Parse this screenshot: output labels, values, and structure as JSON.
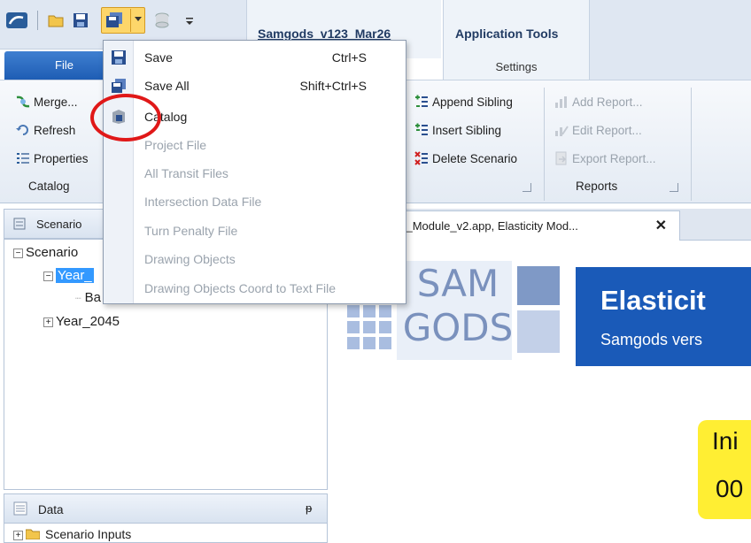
{
  "title_bar": {
    "document_tab": "Samgods_v123_Mar26",
    "app_tools": "Application Tools",
    "settings": "Settings"
  },
  "file_tab": "File",
  "ribbon": {
    "catalog_group": {
      "label": "Catalog",
      "merge": "Merge...",
      "refresh": "Refresh",
      "properties": "Properties"
    },
    "scenario_group": {
      "append_sibling": "Append Sibling",
      "insert_sibling": "Insert Sibling",
      "delete_scenario": "Delete Scenario"
    },
    "reports_group": {
      "label": "Reports",
      "add_report": "Add Report...",
      "edit_report": "Edit Report...",
      "export_report": "Export Report..."
    }
  },
  "save_menu": {
    "items": [
      {
        "label": "Save",
        "shortcut": "Ctrl+S",
        "enabled": true
      },
      {
        "label": "Save All",
        "shortcut": "Shift+Ctrl+S",
        "enabled": true
      },
      {
        "label": "Catalog",
        "shortcut": "",
        "enabled": true
      },
      {
        "label": "Project File",
        "shortcut": "",
        "enabled": false
      },
      {
        "label": "All Transit Files",
        "shortcut": "",
        "enabled": false
      },
      {
        "label": "Intersection Data File",
        "shortcut": "",
        "enabled": false
      },
      {
        "label": "Turn Penalty File",
        "shortcut": "",
        "enabled": false
      },
      {
        "label": "Drawing Objects",
        "shortcut": "",
        "enabled": false
      },
      {
        "label": "Drawing Objects Coord to Text File",
        "shortcut": "",
        "enabled": false
      }
    ]
  },
  "scenario_panel": {
    "title": "Scenario",
    "tree": [
      {
        "label": "Scenario",
        "expander": "−"
      },
      {
        "label": "Year_",
        "expander": "−",
        "selected": true
      },
      {
        "label": "Ba",
        "expander": ""
      },
      {
        "label": "Year_2045",
        "expander": "+"
      }
    ]
  },
  "data_panel": {
    "title": "Data",
    "pin": "ᵽ",
    "items": [
      {
        "label": "Scenario Inputs",
        "expander": "+"
      }
    ]
  },
  "document_tab": {
    "label": "city_Module_v2.app, Elasticity Mod...",
    "close": "✕"
  },
  "document": {
    "logo_line1": "SAM",
    "logo_line2": "GODS",
    "banner_title": "Elasticit",
    "banner_subtitle": "Samgods vers",
    "yellow_line1": "Ini",
    "yellow_line2": "00"
  },
  "colors": {
    "file_tab": "#2a6ac4",
    "banner": "#1a5ab8",
    "yellow": "#ffee33",
    "highlight": "#e01818"
  },
  "icons": [
    "app-icon",
    "folder-icon",
    "save-icon",
    "save-all-icon",
    "dropdown-arrow-icon",
    "database-icon",
    "customize-icon"
  ]
}
